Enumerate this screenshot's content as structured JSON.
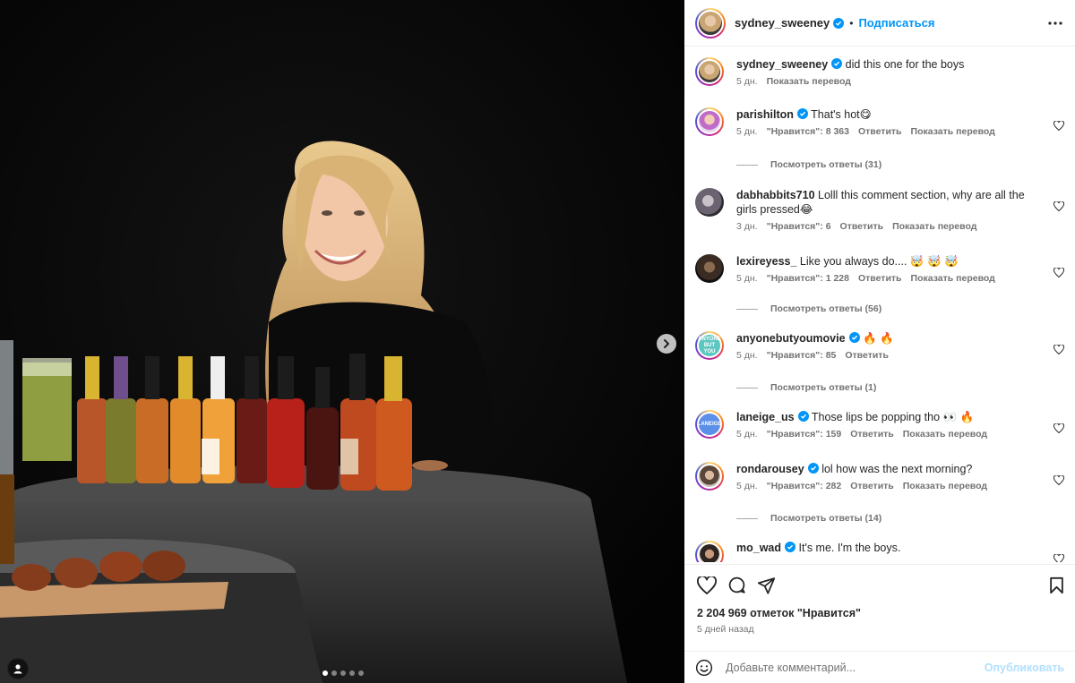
{
  "header": {
    "username": "sydney_sweeney",
    "separator": "•",
    "follow_label": "Подписаться"
  },
  "caption": {
    "username": "sydney_sweeney",
    "text": "did this one for the boys",
    "time": "5 дн.",
    "translate": "Показать перевод"
  },
  "comments": [
    {
      "username": "parishilton",
      "text": "That's hot😋",
      "time": "5 дн.",
      "likes": "\"Нравится\": 8 363",
      "reply": "Ответить",
      "translate": "Показать перевод",
      "replies": "Посмотреть ответы (31)"
    },
    {
      "username": "dabhabbits710",
      "text": "Lolll this comment section, why are all the girls pressed😂",
      "time": "3 дн.",
      "likes": "\"Нравится\": 6",
      "reply": "Ответить",
      "translate": "Показать перевод"
    },
    {
      "username": "lexireyess_",
      "text": "Like you always do.... 🤯 🤯 🤯",
      "time": "5 дн.",
      "likes": "\"Нравится\": 1 228",
      "reply": "Ответить",
      "translate": "Показать перевод",
      "replies": "Посмотреть ответы (56)"
    },
    {
      "username": "anyonebutyoumovie",
      "text": "🔥 🔥",
      "time": "5 дн.",
      "likes": "\"Нравится\": 85",
      "reply": "Ответить",
      "replies": "Посмотреть ответы (1)"
    },
    {
      "username": "laneige_us",
      "text": "Those lips be popping tho 👀 🔥",
      "time": "5 дн.",
      "likes": "\"Нравится\": 159",
      "reply": "Ответить",
      "translate": "Показать перевод"
    },
    {
      "username": "rondarousey",
      "text": "lol how was the next morning?",
      "time": "5 дн.",
      "likes": "\"Нравится\": 282",
      "reply": "Ответить",
      "translate": "Показать перевод",
      "replies": "Посмотреть ответы (14)"
    },
    {
      "username": "mo_wad",
      "text": "It's me. I'm the boys."
    }
  ],
  "actions": {
    "likes_count": "2 204 969 отметок \"Нравится\"",
    "time_ago": "5 дней назад"
  },
  "add_comment": {
    "placeholder": "Добавьте комментарий...",
    "publish_label": "Опубликовать"
  },
  "icons": {
    "like": "heart-icon",
    "comment": "comment-icon",
    "share": "share-icon",
    "save": "bookmark-icon",
    "emoji": "emoji-icon",
    "more": "more-options-icon",
    "next": "chevron-right-icon",
    "tagged": "user-tag-icon"
  },
  "colors": {
    "accent": "#0095f6",
    "verified": "#0095f6",
    "publish_disabled": "#b2dffc",
    "muted_text": "#737373"
  },
  "carousel": {
    "slides": 5,
    "current": 1
  }
}
